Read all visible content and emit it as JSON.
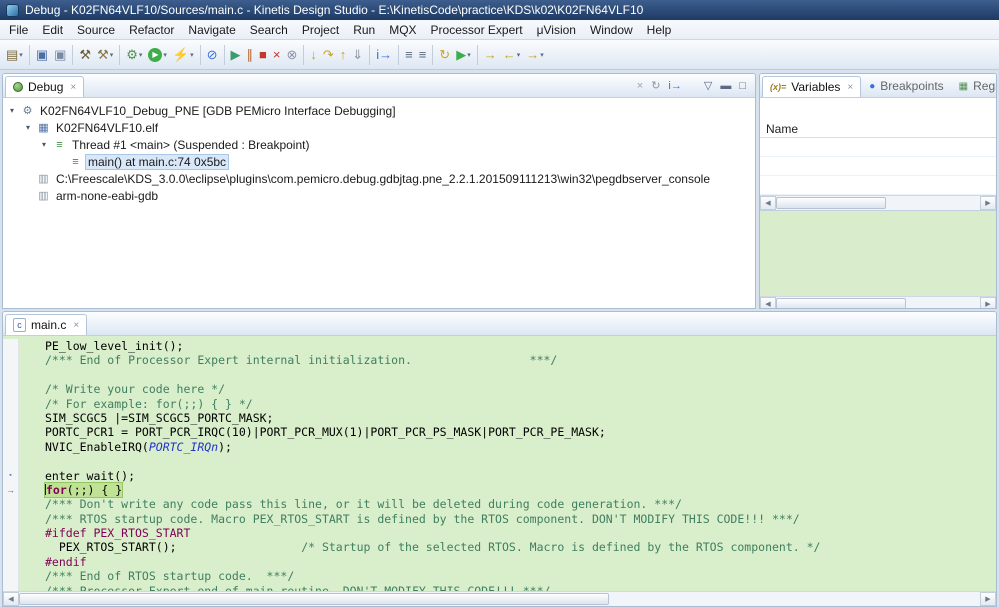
{
  "titlebar": {
    "title": "Debug - K02FN64VLF10/Sources/main.c - Kinetis Design Studio - E:\\KinetisCode\\practice\\KDS\\k02\\K02FN64VLF10"
  },
  "menubar": {
    "items": [
      "File",
      "Edit",
      "Source",
      "Refactor",
      "Navigate",
      "Search",
      "Project",
      "Run",
      "MQX",
      "Processor Expert",
      "μVision",
      "Window",
      "Help"
    ]
  },
  "icons": {
    "close": "×",
    "dropdown": "▾",
    "scroll_left": "◀",
    "scroll_right": "▶",
    "expander_open": "▾",
    "pointer": "→",
    "mark": "▪"
  },
  "toolbar": {
    "items": [
      {
        "name": "new-wizard-dropdown",
        "glyph": "▤",
        "color": "#7a6a3a",
        "dropdown": true
      },
      {
        "sep": true
      },
      {
        "name": "save-icon",
        "glyph": "▣",
        "color": "#4a6fa5"
      },
      {
        "name": "save-all-icon",
        "glyph": "▣",
        "color": "#7a8aa5"
      },
      {
        "sep": true
      },
      {
        "name": "build-all-icon",
        "glyph": "⚒",
        "color": "#6b5b3a"
      },
      {
        "name": "build-config-dropdown",
        "glyph": "⚒",
        "color": "#8a7a4a",
        "dropdown": true
      },
      {
        "sep": true
      },
      {
        "name": "debug-dropdown",
        "glyph": "⚙",
        "color": "#4f8f4f",
        "dropdown": true
      },
      {
        "name": "run-dropdown",
        "glyph": "▶",
        "bg": "#3fae49",
        "color": "#ffffff",
        "dropdown": true
      },
      {
        "name": "flash-programmer-dropdown",
        "glyph": "⚡",
        "color": "#c07f1f",
        "dropdown": true
      },
      {
        "sep": true
      },
      {
        "name": "skip-all-breakpoints-icon",
        "glyph": "⊘",
        "color": "#3a6fd8"
      },
      {
        "sep": true
      },
      {
        "name": "resume-icon",
        "glyph": "▶",
        "color": "#3a9b6e"
      },
      {
        "name": "suspend-icon",
        "glyph": "∥",
        "color": "#b8622a"
      },
      {
        "name": "terminate-icon",
        "glyph": "■",
        "color": "#c0392b"
      },
      {
        "name": "terminate-all-icon",
        "glyph": "×",
        "color": "#c0392b"
      },
      {
        "name": "disconnect-icon",
        "glyph": "⊗",
        "color": "#8a94a5"
      },
      {
        "sep": true
      },
      {
        "name": "step-into-icon",
        "glyph": "↓",
        "color": "#c9a227"
      },
      {
        "name": "step-over-icon",
        "glyph": "↷",
        "color": "#c9a227"
      },
      {
        "name": "step-return-icon",
        "glyph": "↑",
        "color": "#c9a227"
      },
      {
        "name": "drop-to-frame-icon",
        "glyph": "⇓",
        "color": "#8a94a5"
      },
      {
        "sep": true
      },
      {
        "name": "instruction-stepping-icon",
        "glyph": "i→",
        "color": "#3a6fd8"
      },
      {
        "sep": true
      },
      {
        "name": "console-list-icon",
        "glyph": "≡",
        "color": "#5a6b80"
      },
      {
        "name": "memory-list-icon",
        "glyph": "≡",
        "color": "#5a6b80"
      },
      {
        "sep": true
      },
      {
        "name": "refresh-icon",
        "glyph": "↻",
        "color": "#c9a227"
      },
      {
        "name": "external-tools-dropdown",
        "glyph": "▶",
        "color": "#3fae49",
        "dropdown": true
      },
      {
        "sep": true
      },
      {
        "name": "last-edit-location-icon",
        "glyph": "→",
        "color": "#c9a227"
      },
      {
        "name": "back-dropdown",
        "glyph": "←",
        "color": "#c9a227",
        "dropdown": true
      },
      {
        "name": "forward-dropdown",
        "glyph": "→",
        "color": "#c9a227",
        "dropdown": true
      }
    ]
  },
  "debug_panel": {
    "tab_label": "Debug",
    "toolbar_icons": [
      {
        "name": "remove-all-terminated-icon",
        "glyph": "×",
        "color": "#9aa4b5"
      },
      {
        "name": "restart-icon",
        "glyph": "↻",
        "color": "#8a94a5"
      },
      {
        "name": "instruction-pointer-icon",
        "glyph": "i→",
        "color": "#3a6fd8"
      },
      {
        "spacer": true
      },
      {
        "name": "view-menu-icon",
        "glyph": "▽",
        "color": "#5a6b80"
      },
      {
        "name": "minimize-icon",
        "glyph": "▬",
        "color": "#5a6b80"
      },
      {
        "name": "maximize-icon",
        "glyph": "□",
        "color": "#5a6b80"
      }
    ],
    "tree": [
      {
        "label": "K02FN64VLF10_Debug_PNE [GDB PEMicro Interface Debugging]",
        "level": 0,
        "expander": true,
        "icon": "launch-config-icon",
        "glyph": "⚙",
        "color": "#6b7a8d"
      },
      {
        "label": "K02FN64VLF10.elf",
        "level": 1,
        "expander": true,
        "icon": "elf-binary-icon",
        "glyph": "▦",
        "color": "#4a6fa5"
      },
      {
        "label": "Thread #1 <main> (Suspended : Breakpoint)",
        "level": 2,
        "expander": true,
        "icon": "thread-icon",
        "glyph": "≡",
        "color": "#3f8f3f"
      },
      {
        "label": "main() at main.c:74 0x5bc",
        "level": 3,
        "expander": false,
        "icon": "stack-frame-icon",
        "glyph": "≡",
        "color": "#3a6fd8",
        "selected": true
      },
      {
        "label": "C:\\Freescale\\KDS_3.0.0\\eclipse\\plugins\\com.pemicro.debug.gdbjtag.pne_2.2.1.201509111213\\win32\\pegdbserver_console",
        "level": 1,
        "expander": false,
        "icon": "process-icon",
        "glyph": "▥",
        "color": "#8a94a5"
      },
      {
        "label": "arm-none-eabi-gdb",
        "level": 1,
        "expander": false,
        "icon": "process-icon",
        "glyph": "▥",
        "color": "#8a94a5"
      }
    ]
  },
  "variables_panel": {
    "tabs": [
      {
        "name": "tab-variables",
        "icon": "variables-icon",
        "icon_glyph": "(x)=",
        "label": "Variables",
        "selected": true
      },
      {
        "name": "tab-breakpoints",
        "icon": "breakpoints-icon",
        "icon_glyph": "●",
        "icon_color": "#3a6fd8",
        "label": "Breakpoints"
      },
      {
        "name": "tab-registers",
        "icon": "registers-icon",
        "icon_glyph": "▦",
        "icon_color": "#4f8f4f",
        "label": "Registers"
      }
    ],
    "columns": [
      "Name"
    ]
  },
  "editor": {
    "tab_label": "main.c",
    "tab_icon_glyph": "c",
    "lines": [
      {
        "s": [
          [
            "PE_low_level_init();",
            "plain"
          ]
        ]
      },
      {
        "s": [
          [
            "/*** End of Processor Expert internal initialization.                 ***/",
            "comment"
          ]
        ]
      },
      {
        "s": []
      },
      {
        "s": [
          [
            "/* Write your code here */",
            "comment"
          ]
        ]
      },
      {
        "s": [
          [
            "/* For example: for(;;) { } */",
            "comment"
          ]
        ]
      },
      {
        "s": [
          [
            "SIM_SCGC5 |=SIM_SCGC5_PORTC_MASK;",
            "plain"
          ]
        ]
      },
      {
        "s": [
          [
            "PORTC_PCR1 = PORT_PCR_IRQC(10)|PORT_PCR_MUX(1)|PORT_PCR_PS_MASK|PORT_PCR_PE_MASK;",
            "plain"
          ]
        ]
      },
      {
        "s": [
          [
            "NVIC_EnableIRQ(",
            "plain"
          ],
          [
            "PORTC_IRQn",
            "enum"
          ],
          [
            ");",
            "plain"
          ]
        ]
      },
      {
        "s": []
      },
      {
        "s": [
          [
            "enter_wait();",
            "plain"
          ]
        ],
        "g": "mark"
      },
      {
        "s": [
          [
            "for",
            "kw"
          ],
          [
            "(;;) { }",
            "plain"
          ]
        ],
        "cur": true,
        "g": "pointer"
      },
      {
        "s": [
          [
            "/*** Don't write any code pass this line, or it will be deleted during code generation. ***/",
            "comment"
          ]
        ]
      },
      {
        "s": [
          [
            "/*** RTOS startup code. Macro PEX_RTOS_START is defined by the RTOS component. DON'T MODIFY THIS CODE!!! ***/",
            "comment"
          ]
        ]
      },
      {
        "s": [
          [
            "#ifdef PEX_RTOS_START",
            "pp"
          ]
        ]
      },
      {
        "s": [
          [
            "  PEX_RTOS_START();                  ",
            "plain"
          ],
          [
            "/* Startup of the selected RTOS. Macro is defined by the RTOS component. */",
            "comment"
          ]
        ]
      },
      {
        "s": [
          [
            "#endif",
            "pp"
          ]
        ]
      },
      {
        "s": [
          [
            "/*** End of RTOS startup code.  ***/",
            "comment"
          ]
        ]
      },
      {
        "s": [
          [
            "/*** Processor Expert end of main routine. DON'T MODIFY THIS CODE!!! ***/",
            "comment"
          ]
        ]
      }
    ]
  },
  "colors": {
    "titlebar_blue": "#1d3a63",
    "editor_background": "#d9eecb",
    "current_line_highlight": "#bfe295",
    "detail_pane_green": "#d9edcc",
    "comment_green": "#3f7f5f",
    "keyword_purple": "#7f0055",
    "enum_blue": "#2233cc"
  }
}
